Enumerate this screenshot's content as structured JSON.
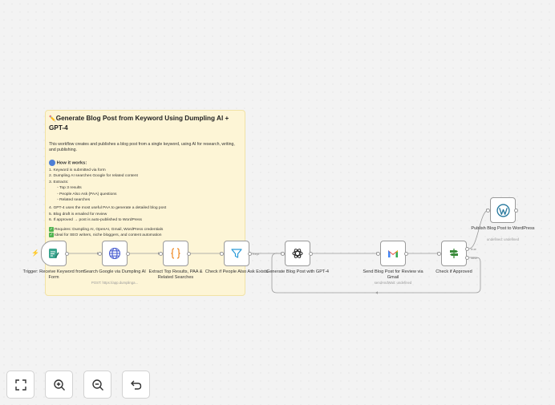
{
  "sticky_note": {
    "title": "Generate Blog Post from Keyword Using Dumpling AI + GPT-4",
    "description": "This workflow creates and publishes a blog post from a single keyword, using AI for research, writing, and publishing.",
    "how_it_works": "How it works:",
    "steps": [
      "1. Keyword is submitted via form",
      "2. Dumpling AI searches Google for related content",
      "3. Extracts:"
    ],
    "sub_items": [
      "Top 3 results",
      "People Also Ask (PAA) questions",
      "Related searches"
    ],
    "steps_after": [
      "4. GPT-4 uses the most useful PAA to generate a detailed blog post",
      "5. Blog draft is emailed for review",
      "6. If approved → post is auto-published to WordPress"
    ],
    "requires": "Requires: Dumpling AI, OpenAI, Gmail, WordPress credentials",
    "ideal_for": "Ideal for SEO writers, niche bloggers, and content automation"
  },
  "nodes": [
    {
      "label": "Trigger: Receive Keyword from Form",
      "sublabel": "",
      "icon": "form-icon"
    },
    {
      "label": "Search Google via Dumpling AI",
      "sublabel": "POST: https://app.dumplinga...",
      "icon": "globe-icon"
    },
    {
      "label": "Extract Top Results, PAA & Related Searches",
      "sublabel": "",
      "icon": "code-braces-icon"
    },
    {
      "label": "Check if People Also Ask Exists",
      "sublabel": "",
      "icon": "filter-icon"
    },
    {
      "label": "Generate Blog Post with GPT-4",
      "sublabel": "",
      "icon": "openai-icon"
    },
    {
      "label": "Send Blog Post for Review via Gmail",
      "sublabel": "sendAndWait: undefined",
      "icon": "gmail-icon"
    },
    {
      "label": "Check if Approved",
      "sublabel": "",
      "icon": "signpost-icon"
    },
    {
      "label": "Publish Blog Post to WordPress",
      "sublabel": "undefined: undefined",
      "icon": "wordpress-icon"
    }
  ],
  "edge_labels": {
    "filter_output": "Kept",
    "if_true": "true",
    "if_false": "false"
  },
  "colors": {
    "trigger_icon": "#3aa58f",
    "globe": "#4a5fd0",
    "code": "#f08a24",
    "filter": "#2a9ad8",
    "wordpress": "#21759b",
    "signpost": "#3b8b3b",
    "bolt": "#e65f3a"
  },
  "controls": [
    "fit-view",
    "zoom-in",
    "zoom-out",
    "undo"
  ]
}
